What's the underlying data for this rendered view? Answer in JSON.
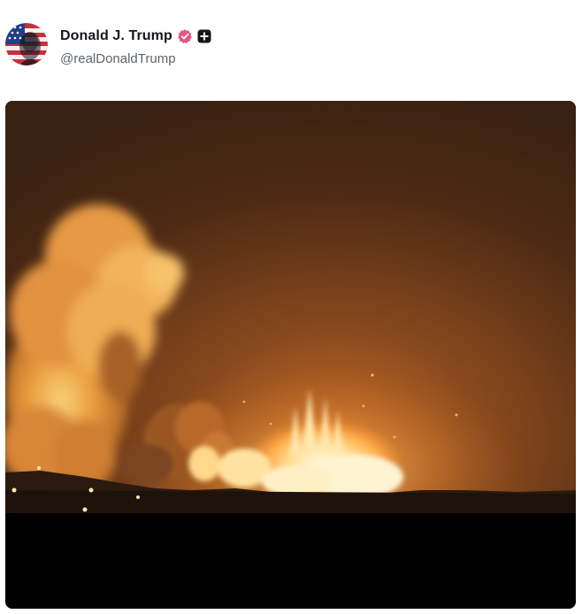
{
  "post": {
    "author": {
      "display_name": "Donald J. Trump",
      "handle": "@realDonaldTrump"
    },
    "badges": {
      "verified_icon": "verified-badge-icon",
      "verified_color": "#e4577f",
      "plus_icon": "plus-badge-icon",
      "plus_color": "#14161a"
    },
    "media": {
      "type": "video-still"
    }
  }
}
